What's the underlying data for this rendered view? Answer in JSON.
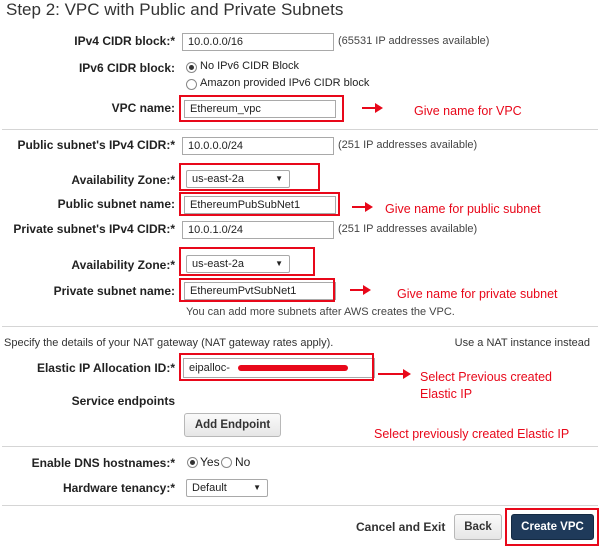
{
  "page": {
    "title": "Step 2: VPC with Public and Private Subnets"
  },
  "form": {
    "ipv4_cidr": {
      "label": "IPv4 CIDR block:*",
      "value": "10.0.0.0/16",
      "note": "(65531 IP addresses available)"
    },
    "ipv6_cidr": {
      "label": "IPv6 CIDR block:",
      "option1": "No IPv6 CIDR Block",
      "option2": "Amazon provided IPv6 CIDR block",
      "selected": "No IPv6 CIDR Block"
    },
    "vpc_name": {
      "label": "VPC name:",
      "value": "Ethereum_vpc"
    },
    "public_subnet_cidr": {
      "label": "Public subnet's IPv4 CIDR:*",
      "value": "10.0.0.0/24",
      "note": "(251 IP addresses available)"
    },
    "public_az": {
      "label": "Availability Zone:*",
      "value": "us-east-2a"
    },
    "public_subnet_name": {
      "label": "Public subnet name:",
      "value": "EthereumPubSubNet1"
    },
    "private_subnet_cidr": {
      "label": "Private subnet's IPv4 CIDR:*",
      "value": "10.0.1.0/24",
      "note": "(251 IP addresses available)"
    },
    "private_az": {
      "label": "Availability Zone:*",
      "value": "us-east-2a"
    },
    "private_subnet_name": {
      "label": "Private subnet name:",
      "value": "EthereumPvtSubNet1"
    },
    "more_subnets_note": "You can add more subnets after AWS creates the VPC.",
    "nat_text": "Specify the details of your NAT gateway (NAT gateway rates apply).",
    "nat_instance_link": "Use a NAT instance instead",
    "eip": {
      "label": "Elastic IP Allocation ID:*",
      "value": "eipalloc-"
    },
    "service_endpoints_label": "Service endpoints",
    "add_endpoint_label": "Add Endpoint",
    "dns_hostnames": {
      "label": "Enable DNS hostnames:*",
      "yes": "Yes",
      "no": "No",
      "selected": "Yes"
    },
    "tenancy": {
      "label": "Hardware tenancy:*",
      "value": "Default"
    }
  },
  "footer": {
    "cancel_label": "Cancel and Exit",
    "back_label": "Back",
    "create_label": "Create VPC"
  },
  "annotations": {
    "vpc_name": "Give name for VPC",
    "public_subnet": "Give name for public subnet",
    "private_subnet": "Give name for private subnet",
    "eip_line1": "Select Previous created",
    "eip_line2": "Elastic IP",
    "eip_alt": "Select previously created Elastic IP"
  },
  "colors": {
    "annotation_red": "#e8081a",
    "primary_button": "#1f3a5a"
  }
}
